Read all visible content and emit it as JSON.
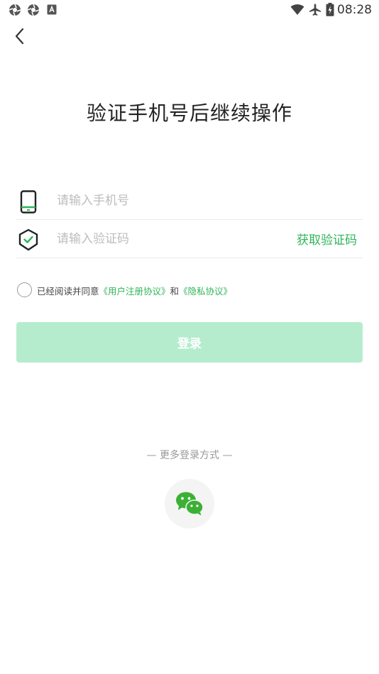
{
  "status_bar": {
    "time": "08:28",
    "left_icons": [
      "aperture-icon",
      "aperture-icon",
      "a-notification-icon"
    ],
    "right_icons": [
      "wifi-icon",
      "airplane-icon",
      "battery-charging-icon"
    ]
  },
  "nav": {
    "back_icon": "chevron-left-icon"
  },
  "page": {
    "title": "验证手机号后继续操作"
  },
  "form": {
    "phone": {
      "placeholder": "请输入手机号",
      "value": "",
      "icon": "phone-icon"
    },
    "code": {
      "placeholder": "请输入验证码",
      "value": "",
      "icon": "shield-check-icon",
      "get_code_label": "获取验证码"
    }
  },
  "agreement": {
    "prefix": "已经阅读并同意",
    "user_agreement": "《用户注册协议》",
    "connector": "和",
    "privacy_policy": "《隐私协议》",
    "checked": false
  },
  "login": {
    "label": "登录"
  },
  "more_login": {
    "label": "— 更多登录方式 —",
    "wechat_icon": "wechat-icon"
  },
  "colors": {
    "accent": "#2fb559",
    "button_disabled": "#b6ecce",
    "placeholder": "#bdbdbd"
  }
}
